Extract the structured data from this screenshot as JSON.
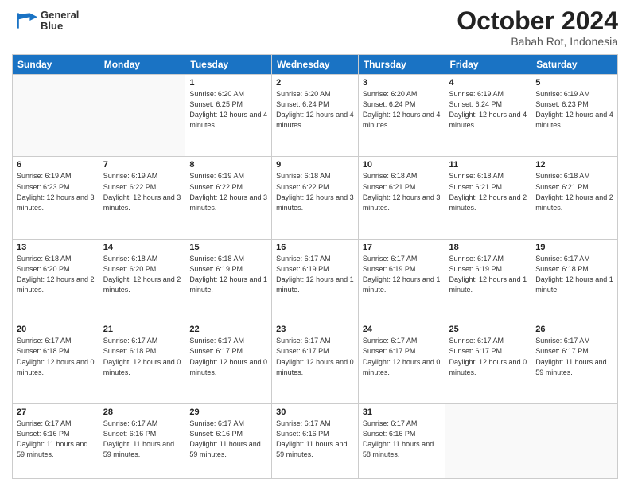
{
  "header": {
    "logo_line1": "General",
    "logo_line2": "Blue",
    "month": "October 2024",
    "location": "Babah Rot, Indonesia"
  },
  "weekdays": [
    "Sunday",
    "Monday",
    "Tuesday",
    "Wednesday",
    "Thursday",
    "Friday",
    "Saturday"
  ],
  "weeks": [
    [
      {
        "day": "",
        "info": ""
      },
      {
        "day": "",
        "info": ""
      },
      {
        "day": "1",
        "info": "Sunrise: 6:20 AM\nSunset: 6:25 PM\nDaylight: 12 hours and 4 minutes."
      },
      {
        "day": "2",
        "info": "Sunrise: 6:20 AM\nSunset: 6:24 PM\nDaylight: 12 hours and 4 minutes."
      },
      {
        "day": "3",
        "info": "Sunrise: 6:20 AM\nSunset: 6:24 PM\nDaylight: 12 hours and 4 minutes."
      },
      {
        "day": "4",
        "info": "Sunrise: 6:19 AM\nSunset: 6:24 PM\nDaylight: 12 hours and 4 minutes."
      },
      {
        "day": "5",
        "info": "Sunrise: 6:19 AM\nSunset: 6:23 PM\nDaylight: 12 hours and 4 minutes."
      }
    ],
    [
      {
        "day": "6",
        "info": "Sunrise: 6:19 AM\nSunset: 6:23 PM\nDaylight: 12 hours and 3 minutes."
      },
      {
        "day": "7",
        "info": "Sunrise: 6:19 AM\nSunset: 6:22 PM\nDaylight: 12 hours and 3 minutes."
      },
      {
        "day": "8",
        "info": "Sunrise: 6:19 AM\nSunset: 6:22 PM\nDaylight: 12 hours and 3 minutes."
      },
      {
        "day": "9",
        "info": "Sunrise: 6:18 AM\nSunset: 6:22 PM\nDaylight: 12 hours and 3 minutes."
      },
      {
        "day": "10",
        "info": "Sunrise: 6:18 AM\nSunset: 6:21 PM\nDaylight: 12 hours and 3 minutes."
      },
      {
        "day": "11",
        "info": "Sunrise: 6:18 AM\nSunset: 6:21 PM\nDaylight: 12 hours and 2 minutes."
      },
      {
        "day": "12",
        "info": "Sunrise: 6:18 AM\nSunset: 6:21 PM\nDaylight: 12 hours and 2 minutes."
      }
    ],
    [
      {
        "day": "13",
        "info": "Sunrise: 6:18 AM\nSunset: 6:20 PM\nDaylight: 12 hours and 2 minutes."
      },
      {
        "day": "14",
        "info": "Sunrise: 6:18 AM\nSunset: 6:20 PM\nDaylight: 12 hours and 2 minutes."
      },
      {
        "day": "15",
        "info": "Sunrise: 6:18 AM\nSunset: 6:19 PM\nDaylight: 12 hours and 1 minute."
      },
      {
        "day": "16",
        "info": "Sunrise: 6:17 AM\nSunset: 6:19 PM\nDaylight: 12 hours and 1 minute."
      },
      {
        "day": "17",
        "info": "Sunrise: 6:17 AM\nSunset: 6:19 PM\nDaylight: 12 hours and 1 minute."
      },
      {
        "day": "18",
        "info": "Sunrise: 6:17 AM\nSunset: 6:19 PM\nDaylight: 12 hours and 1 minute."
      },
      {
        "day": "19",
        "info": "Sunrise: 6:17 AM\nSunset: 6:18 PM\nDaylight: 12 hours and 1 minute."
      }
    ],
    [
      {
        "day": "20",
        "info": "Sunrise: 6:17 AM\nSunset: 6:18 PM\nDaylight: 12 hours and 0 minutes."
      },
      {
        "day": "21",
        "info": "Sunrise: 6:17 AM\nSunset: 6:18 PM\nDaylight: 12 hours and 0 minutes."
      },
      {
        "day": "22",
        "info": "Sunrise: 6:17 AM\nSunset: 6:17 PM\nDaylight: 12 hours and 0 minutes."
      },
      {
        "day": "23",
        "info": "Sunrise: 6:17 AM\nSunset: 6:17 PM\nDaylight: 12 hours and 0 minutes."
      },
      {
        "day": "24",
        "info": "Sunrise: 6:17 AM\nSunset: 6:17 PM\nDaylight: 12 hours and 0 minutes."
      },
      {
        "day": "25",
        "info": "Sunrise: 6:17 AM\nSunset: 6:17 PM\nDaylight: 12 hours and 0 minutes."
      },
      {
        "day": "26",
        "info": "Sunrise: 6:17 AM\nSunset: 6:17 PM\nDaylight: 11 hours and 59 minutes."
      }
    ],
    [
      {
        "day": "27",
        "info": "Sunrise: 6:17 AM\nSunset: 6:16 PM\nDaylight: 11 hours and 59 minutes."
      },
      {
        "day": "28",
        "info": "Sunrise: 6:17 AM\nSunset: 6:16 PM\nDaylight: 11 hours and 59 minutes."
      },
      {
        "day": "29",
        "info": "Sunrise: 6:17 AM\nSunset: 6:16 PM\nDaylight: 11 hours and 59 minutes."
      },
      {
        "day": "30",
        "info": "Sunrise: 6:17 AM\nSunset: 6:16 PM\nDaylight: 11 hours and 59 minutes."
      },
      {
        "day": "31",
        "info": "Sunrise: 6:17 AM\nSunset: 6:16 PM\nDaylight: 11 hours and 58 minutes."
      },
      {
        "day": "",
        "info": ""
      },
      {
        "day": "",
        "info": ""
      }
    ]
  ]
}
